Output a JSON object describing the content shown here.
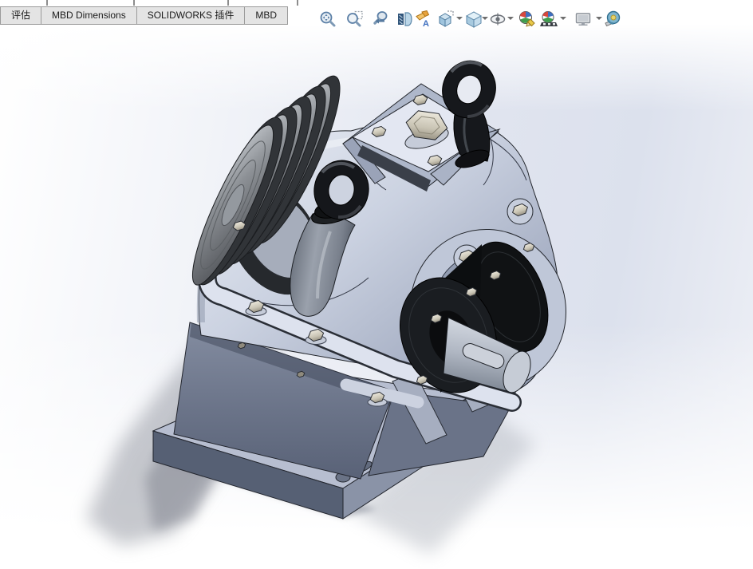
{
  "command_tabs": {
    "items": [
      {
        "label": "评估"
      },
      {
        "label": "MBD Dimensions"
      },
      {
        "label": "SOLIDWORKS 插件"
      },
      {
        "label": "MBD"
      }
    ]
  },
  "heads_up_toolbar": {
    "items": [
      {
        "icon": "zoom-to-fit-icon",
        "has_dropdown": false
      },
      {
        "icon": "zoom-to-area-icon",
        "has_dropdown": false
      },
      {
        "icon": "previous-view-icon",
        "has_dropdown": false
      },
      {
        "icon": "section-view-icon",
        "has_dropdown": false
      },
      {
        "icon": "dynamic-annotation-views-icon",
        "has_dropdown": false
      },
      {
        "icon": "view-orientation-icon",
        "has_dropdown": true
      },
      {
        "icon": "display-style-icon",
        "has_dropdown": true
      },
      {
        "icon": "hide-show-items-icon",
        "has_dropdown": true
      },
      {
        "icon": "edit-appearance-icon",
        "has_dropdown": false
      },
      {
        "icon": "apply-scene-icon",
        "has_dropdown": true
      },
      {
        "icon": "view-settings-icon",
        "has_dropdown": true
      },
      {
        "icon": "measure-icon",
        "has_dropdown": false
      }
    ]
  },
  "viewport": {
    "colors": {
      "background_accent": "#dde2ee",
      "housing_light": "#c6cddd",
      "housing_dark": "#6b7489",
      "pulley_grey": "#85898f",
      "black_hardware": "#17191c",
      "bolt_metal": "#d8d4c6",
      "shaft_metal": "#aab2bf",
      "shadow": "#8f939d"
    }
  }
}
